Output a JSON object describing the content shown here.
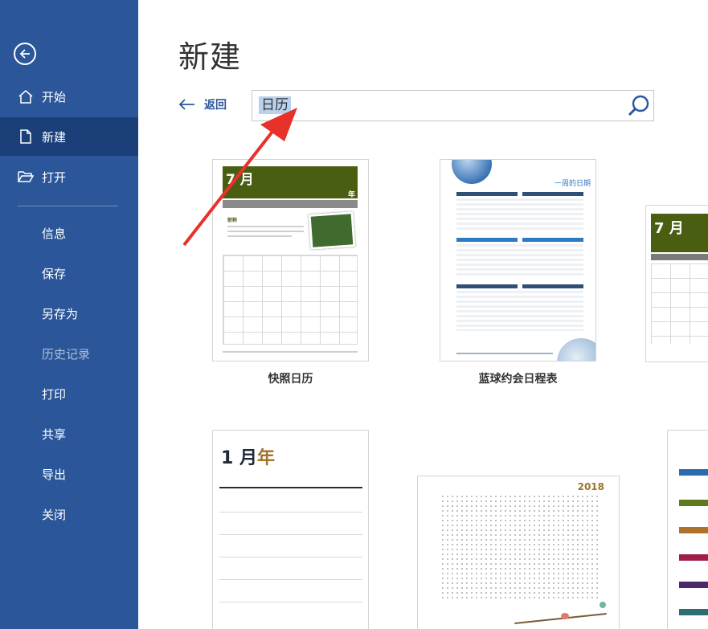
{
  "sidebar": {
    "items": [
      {
        "label": "开始"
      },
      {
        "label": "新建"
      },
      {
        "label": "打开"
      },
      {
        "label": "信息"
      },
      {
        "label": "保存"
      },
      {
        "label": "另存为"
      },
      {
        "label": "历史记录"
      },
      {
        "label": "打印"
      },
      {
        "label": "共享"
      },
      {
        "label": "导出"
      },
      {
        "label": "关闭"
      }
    ]
  },
  "main": {
    "title": "新建",
    "back_label": "返回",
    "search": {
      "value": "日历"
    }
  },
  "templates": [
    {
      "name": "快照日历",
      "month": "7 月",
      "year": "年",
      "heading": "职称"
    },
    {
      "name": "蓝球约会日程表",
      "heading": "一周的日期"
    },
    {
      "name": "",
      "month": "7 月"
    },
    {
      "name": "",
      "month": "1 月",
      "year": "年"
    },
    {
      "name": "",
      "year": "2018"
    },
    {
      "name": ""
    }
  ],
  "colors": {
    "sidebar": "#2b579a",
    "sidebar_active": "#1a3f79",
    "accent": "#2b579a",
    "annotation_arrow": "#e8312b"
  }
}
